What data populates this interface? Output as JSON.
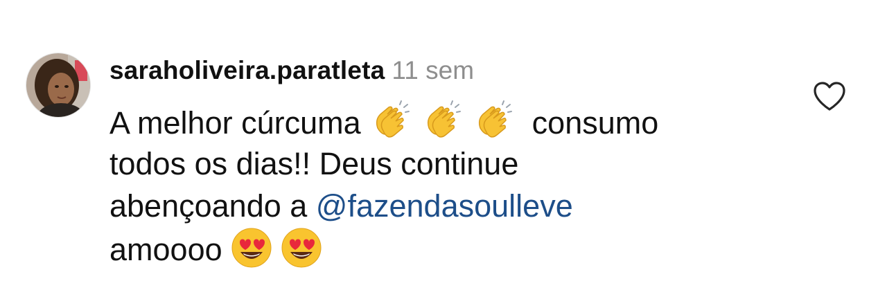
{
  "comment": {
    "username": "saraholiveira.paratleta",
    "time": "11 sem",
    "text": {
      "line1_before": "A melhor cúrcuma",
      "line1_emojis": [
        "clapping-hands",
        "clapping-hands",
        "clapping-hands"
      ],
      "line1_after": "consumo",
      "line2": "todos os dias!! Deus continue",
      "line3_before": "abençoando a",
      "line3_mention": "@fazendasoulleve",
      "line4_before": "amoooo",
      "line4_emojis": [
        "smiling-face-with-heart-eyes",
        "smiling-face-with-heart-eyes"
      ]
    },
    "icons": {
      "like": "heart-outline-icon",
      "avatar": "profile-photo"
    },
    "colors": {
      "text": "#111111",
      "timestamp": "#8e8e8e",
      "mention": "#1d4e89",
      "icon": "#262626"
    }
  }
}
